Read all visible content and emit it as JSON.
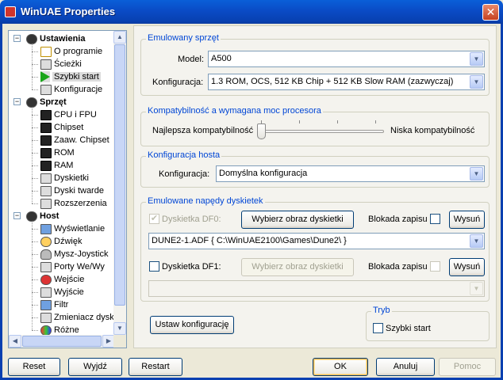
{
  "window": {
    "title": "WinUAE Properties",
    "close_glyph": "✕"
  },
  "tree": {
    "items": [
      {
        "label": "Ustawienia",
        "bold": true,
        "icon": "settings-root-icon"
      },
      {
        "label": "O programie",
        "icon": "check-icon"
      },
      {
        "label": "Ścieżki",
        "icon": "paths-icon"
      },
      {
        "label": "Szybki start",
        "icon": "play-icon",
        "selected": true
      },
      {
        "label": "Konfiguracje",
        "icon": "config-icon"
      },
      {
        "label": "Sprzęt",
        "bold": true,
        "icon": "gear-icon"
      },
      {
        "label": "CPU i FPU",
        "icon": "chip-icon"
      },
      {
        "label": "Chipset",
        "icon": "chip-icon"
      },
      {
        "label": "Zaaw. Chipset",
        "icon": "chip-icon"
      },
      {
        "label": "ROM",
        "icon": "chip-icon"
      },
      {
        "label": "RAM",
        "icon": "chip-icon"
      },
      {
        "label": "Dyskietki",
        "icon": "floppy-icon"
      },
      {
        "label": "Dyski twarde",
        "icon": "harddisk-icon"
      },
      {
        "label": "Rozszerzenia",
        "icon": "expansion-icon"
      },
      {
        "label": "Host",
        "bold": true,
        "icon": "gear-icon"
      },
      {
        "label": "Wyświetlanie",
        "icon": "monitor-icon"
      },
      {
        "label": "Dźwięk",
        "icon": "sound-icon"
      },
      {
        "label": "Mysz-Joystick",
        "icon": "mouse-icon"
      },
      {
        "label": "Porty We/Wy",
        "icon": "ports-icon"
      },
      {
        "label": "Wejście",
        "icon": "joystick-icon"
      },
      {
        "label": "Wyjście",
        "icon": "output-icon"
      },
      {
        "label": "Filtr",
        "icon": "monitor-icon"
      },
      {
        "label": "Zmieniacz dysk",
        "icon": "disk-swapper-icon"
      },
      {
        "label": "Różne",
        "icon": "misc-icon"
      }
    ]
  },
  "emulated_hw": {
    "title": "Emulowany sprzęt",
    "model_label": "Model:",
    "model_value": "A500",
    "config_label": "Konfiguracja:",
    "config_value": "1.3 ROM, OCS, 512 KB Chip + 512 KB Slow RAM (zazwyczaj)"
  },
  "compat": {
    "title": "Kompatybilność a wymagana moc procesora",
    "left_label": "Najlepsza kompatybilność",
    "right_label": "Niska kompatybilność",
    "slider_value": 0
  },
  "host_config": {
    "title": "Konfiguracja hosta",
    "config_label": "Konfiguracja:",
    "config_value": "Domyślna konfiguracja"
  },
  "floppies": {
    "title": "Emulowane napędy dyskietek",
    "df0": {
      "label": "Dyskietka DF0:",
      "checked": true,
      "select_button": "Wybierz obraz dyskietki",
      "write_protect_label": "Blokada zapisu",
      "eject_button": "Wysuń",
      "path": "DUNE2-1.ADF { C:\\WinUAE2100\\Games\\Dune2\\ }"
    },
    "df1": {
      "label": "Dyskietka DF1:",
      "checked": false,
      "select_button": "Wybierz obraz dyskietki",
      "write_protect_label": "Blokada zapisu",
      "eject_button": "Wysuń",
      "path": ""
    }
  },
  "mode": {
    "title": "Tryb",
    "quickstart_label": "Szybki start"
  },
  "set_config_button": "Ustaw konfigurację",
  "bottom_buttons": {
    "reset": "Reset",
    "quit": "Wyjdź",
    "restart": "Restart",
    "ok": "OK",
    "cancel": "Anuluj",
    "help": "Pomoc"
  },
  "glyphs": {
    "check": "✔",
    "down": "▼",
    "up": "▲",
    "left": "◀",
    "right": "▶",
    "minus": "−"
  }
}
